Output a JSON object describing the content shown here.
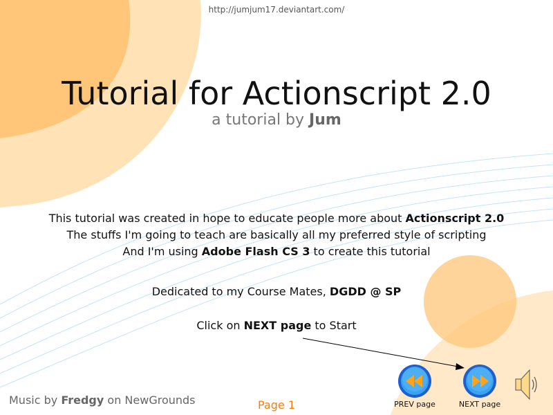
{
  "header": {
    "url": "http://jumjum17.deviantart.com/"
  },
  "title": {
    "main": "Tutorial for Actionscript 2.0",
    "subtitle_prefix": "a tutorial by ",
    "subtitle_author": "Jum"
  },
  "intro": {
    "line1_prefix": "This tutorial was created in hope to educate people more about ",
    "line1_bold": "Actionscript 2.0",
    "line2": "The stuffs I'm going to teach are basically all my preferred style of scripting",
    "line3_prefix": "And I'm using ",
    "line3_bold": "Adobe Flash CS 3",
    "line3_suffix": " to create this tutorial"
  },
  "dedication": {
    "prefix": "Dedicated to my Course Mates, ",
    "bold": "DGDD @ SP"
  },
  "instruction": {
    "prefix": "Click on ",
    "bold": "NEXT page",
    "suffix": " to Start"
  },
  "footer": {
    "music_prefix": "Music by ",
    "music_bold": "Fredgy",
    "music_suffix": " on NewGrounds",
    "page_label": "Page 1"
  },
  "nav": {
    "prev_label": "PREV page",
    "next_label": "NEXT page"
  },
  "icons": {
    "prev": "rewind-icon",
    "next": "forward-icon",
    "sound": "speaker-icon"
  },
  "colors": {
    "orange_light": "#ffe0b0",
    "orange_mid": "#ffc878",
    "accent": "#ff7a00",
    "button_blue": "#1e5fd0",
    "swoosh": "#bfe6f7"
  }
}
